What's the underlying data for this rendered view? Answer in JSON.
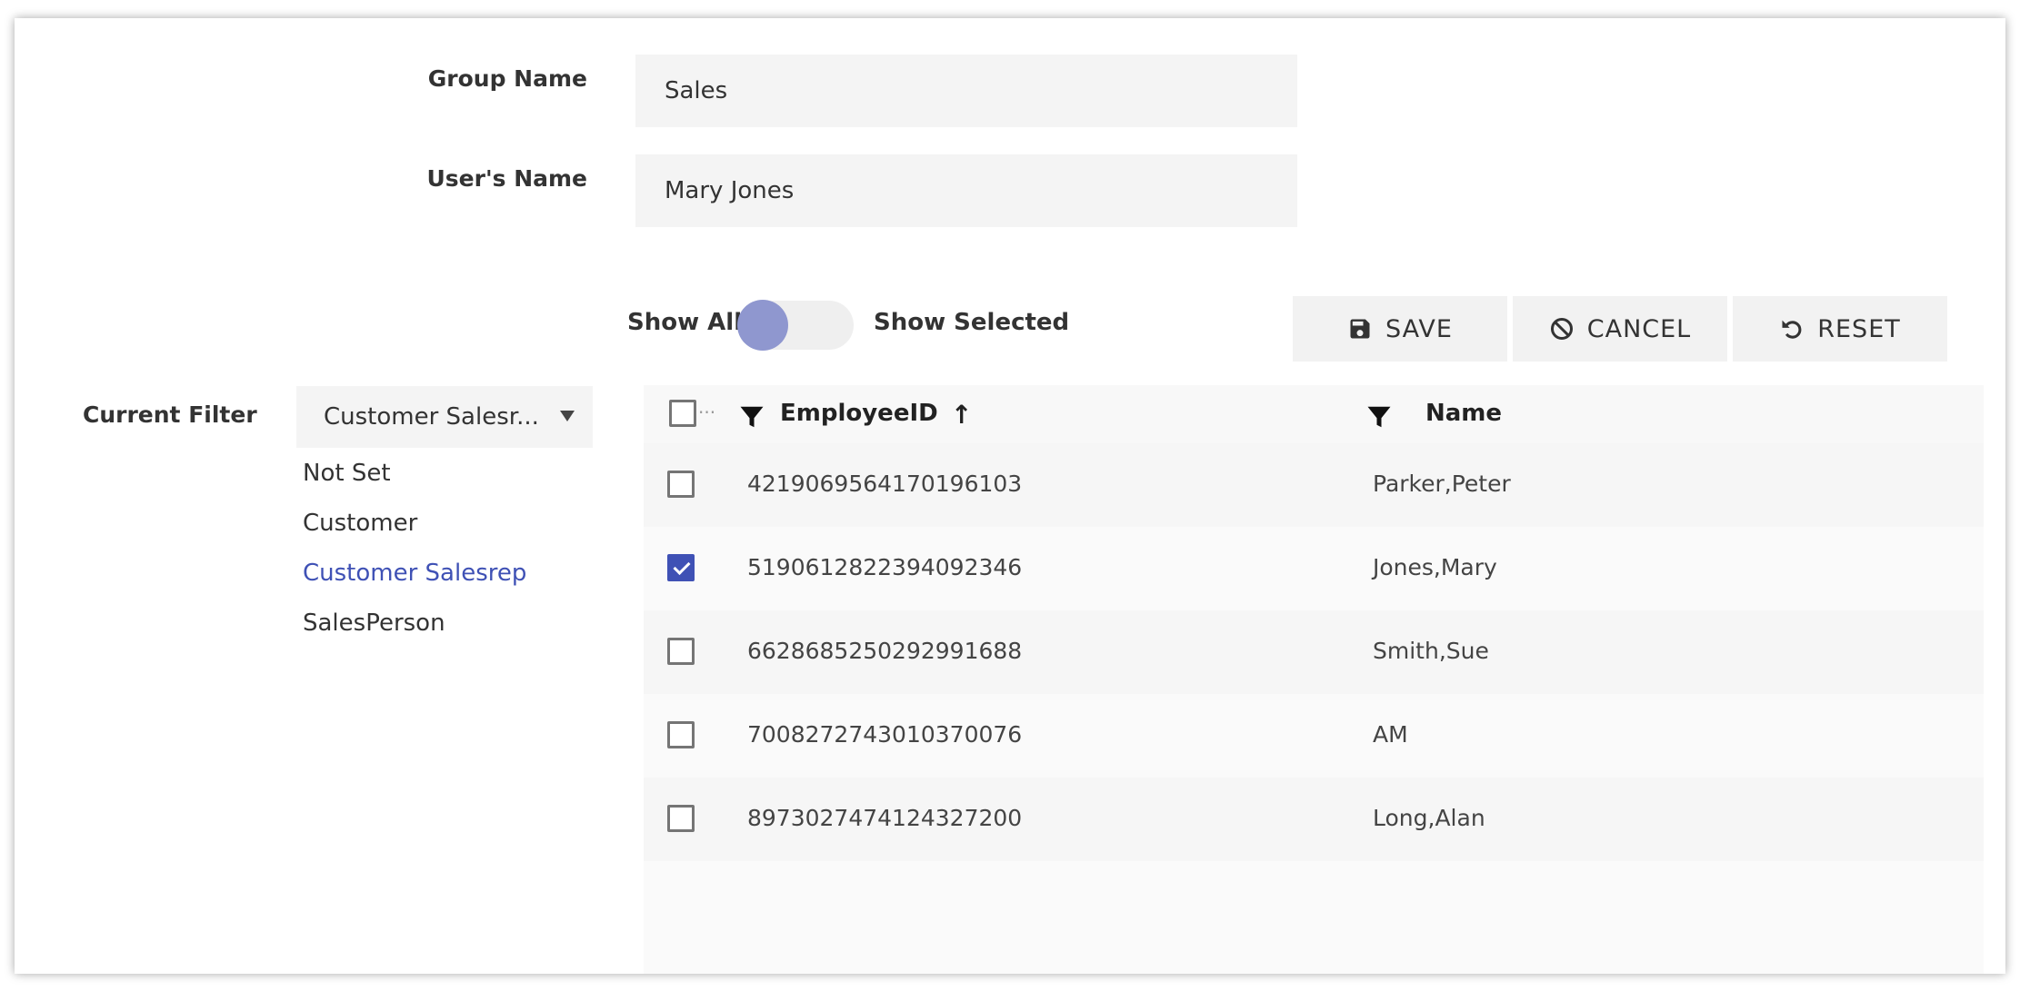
{
  "form": {
    "group_name_label": "Group Name",
    "group_name_value": "Sales",
    "user_name_label": "User's Name",
    "user_name_value": "Mary Jones"
  },
  "toggle": {
    "left_label": "Show All",
    "right_label": "Show Selected",
    "state": "show-all"
  },
  "toolbar": {
    "save_label": "SAVE",
    "cancel_label": "CANCEL",
    "reset_label": "RESET"
  },
  "filter": {
    "label": "Current Filter",
    "selected_display": "Customer Salesr...",
    "options": [
      "Not Set",
      "Customer",
      "Customer Salesrep",
      "SalesPerson"
    ],
    "selected_option": "Customer Salesrep"
  },
  "grid": {
    "columns": {
      "employee_id": "EmployeeID",
      "name": "Name"
    },
    "sort_arrow": "↑",
    "header_ellipsis": "···",
    "rows": [
      {
        "employee_id": "4219069564170196103",
        "name": "Parker,Peter",
        "checked": false
      },
      {
        "employee_id": "5190612822394092346",
        "name": "Jones,Mary",
        "checked": true
      },
      {
        "employee_id": "6628685250292991688",
        "name": "Smith,Sue",
        "checked": false
      },
      {
        "employee_id": "7008272743010370076",
        "name": "AM",
        "checked": false
      },
      {
        "employee_id": "8973027474124327200",
        "name": "Long,Alan",
        "checked": false
      }
    ]
  },
  "colors": {
    "accent": "#3f51b5",
    "toggle_knob": "#8f97cf"
  },
  "icons": {
    "save": "floppy-disk-icon",
    "cancel": "ban-icon",
    "reset": "undo-icon",
    "filter": "funnel-icon",
    "dropdown": "caret-down-icon"
  }
}
